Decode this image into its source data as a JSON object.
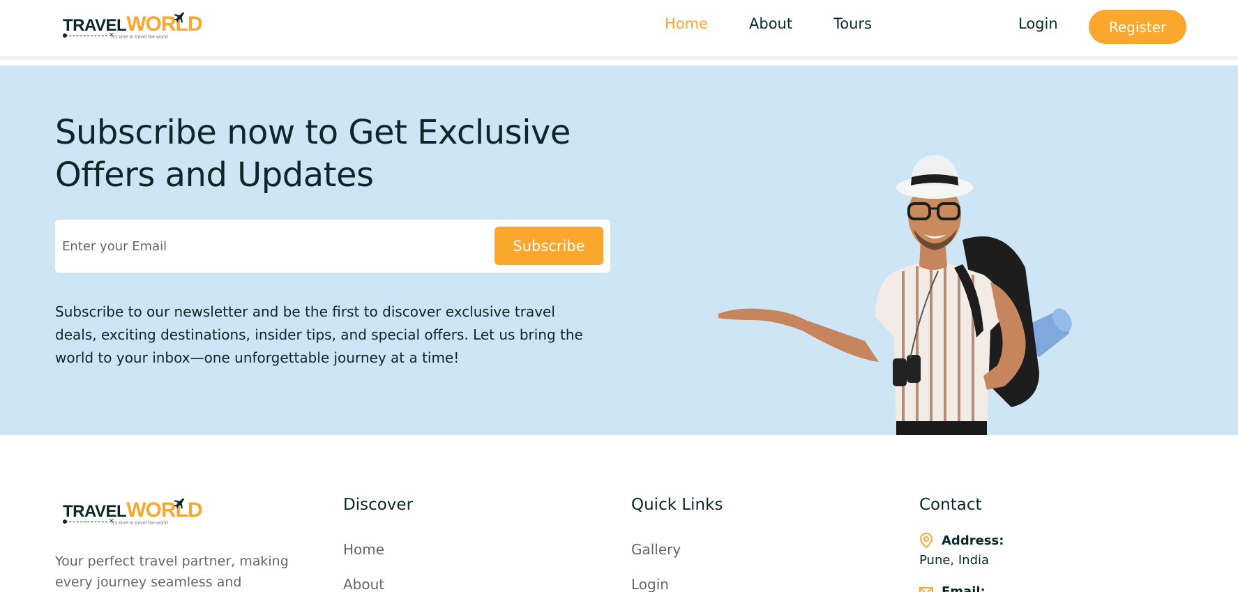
{
  "brand": {
    "logo_primary": "TRAVEL",
    "logo_secondary": "WORLD",
    "tagline": "it's time to travel the world"
  },
  "nav": {
    "items": [
      "Home",
      "About",
      "Tours"
    ],
    "active": "Home",
    "login": "Login",
    "register": "Register"
  },
  "newsletter": {
    "title": "Subscribe now to Get Exclusive Offers and Updates",
    "email_placeholder": "Enter your Email",
    "subscribe": "Subscribe",
    "description": "Subscribe to our newsletter and be the first to discover exclusive travel deals, exciting destinations, insider tips, and special offers. Let us bring the world to your inbox—one unforgettable journey at a time!"
  },
  "footer": {
    "description": "Your perfect travel partner, making every journey seamless and memorable.",
    "discover": {
      "heading": "Discover",
      "links": [
        "Home",
        "About"
      ]
    },
    "quick_links": {
      "heading": "Quick Links",
      "links": [
        "Gallery",
        "Login"
      ]
    },
    "contact": {
      "heading": "Contact",
      "address_label": "Address:",
      "address_value": "Pune, India",
      "email_label": "Email:"
    }
  },
  "colors": {
    "accent": "#f9a72d",
    "heading": "#0b2727",
    "newsletter_bg": "#cde5f5"
  }
}
